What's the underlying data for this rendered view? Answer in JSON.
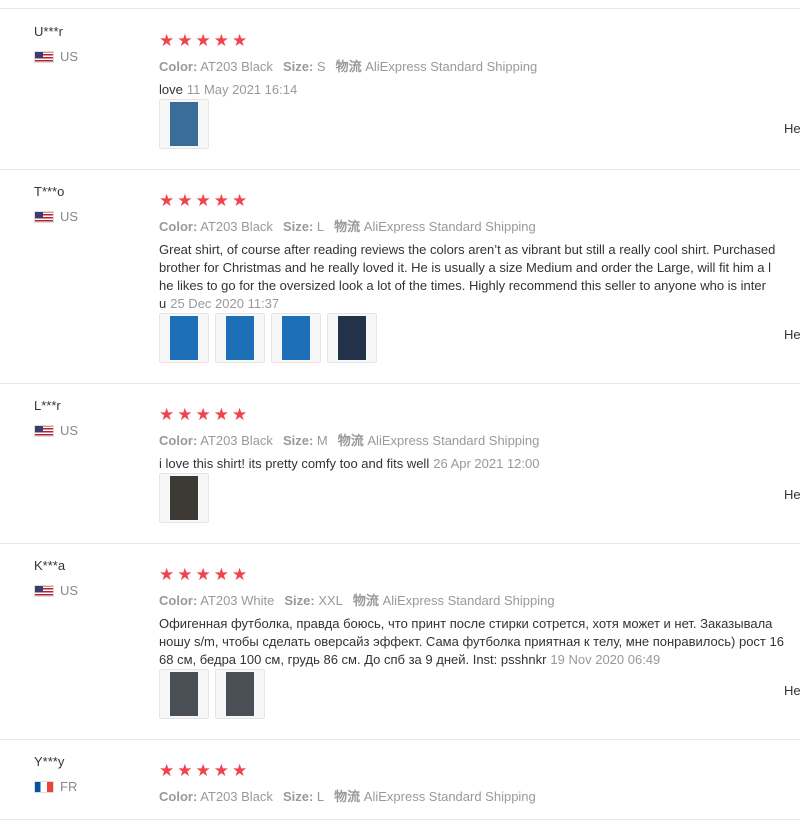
{
  "labels": {
    "color": "Color:",
    "size": "Size:",
    "shipping": "物流",
    "helpful": "He"
  },
  "reviews": [
    {
      "user": "U***r",
      "country": "US",
      "flag": "us",
      "rating": 5,
      "color": "AT203 Black",
      "size": "S",
      "shipping": "AliExpress Standard Shipping",
      "lines": [
        "love"
      ],
      "date": "11 May 2021 16:14",
      "photo_colors": [
        "#3a6d9a"
      ]
    },
    {
      "user": "T***o",
      "country": "US",
      "flag": "us",
      "rating": 5,
      "color": "AT203 Black",
      "size": "L",
      "shipping": "AliExpress Standard Shipping",
      "lines": [
        "Great shirt, of course after reading reviews the colors aren’t as vibrant but still a really cool shirt. Purchased",
        "brother for Christmas and he really loved it. He is usually a size Medium and order the Large, will fit him a l",
        "he likes to go for the oversized look a lot of the times. Highly recommend this seller to anyone who is inter",
        "u"
      ],
      "date": "25 Dec 2020 11:37",
      "photo_colors": [
        "#1d6fb8",
        "#1d6fb8",
        "#1d6fb8",
        "#22324a"
      ]
    },
    {
      "user": "L***r",
      "country": "US",
      "flag": "us",
      "rating": 5,
      "color": "AT203 Black",
      "size": "M",
      "shipping": "AliExpress Standard Shipping",
      "lines": [
        "i love this shirt! its pretty comfy too and fits well"
      ],
      "date": "26 Apr 2021 12:00",
      "photo_colors": [
        "#3d3a36"
      ]
    },
    {
      "user": "K***a",
      "country": "US",
      "flag": "us",
      "rating": 5,
      "color": "AT203 White",
      "size": "XXL",
      "shipping": "AliExpress Standard Shipping",
      "lines": [
        "Офигенная футболка, правда боюсь, что принт после стирки сотрется, хотя может и нет. Заказывала",
        "ношу s/m, чтобы сделать оверсайз эффект. Сама футболка приятная к телу, мне понравилось) рост 16",
        "68 см, бедра 100 см, грудь 86 см. До спб за 9 дней. Inst: psshnkr"
      ],
      "date": "19 Nov 2020 06:49",
      "photo_colors": [
        "#4a4e55",
        "#4a4e55"
      ]
    },
    {
      "user": "Y***y",
      "country": "FR",
      "flag": "fr",
      "rating": 5,
      "color": "AT203 Black",
      "size": "L",
      "shipping": "AliExpress Standard Shipping",
      "lines": [],
      "date": "",
      "photo_colors": []
    }
  ]
}
